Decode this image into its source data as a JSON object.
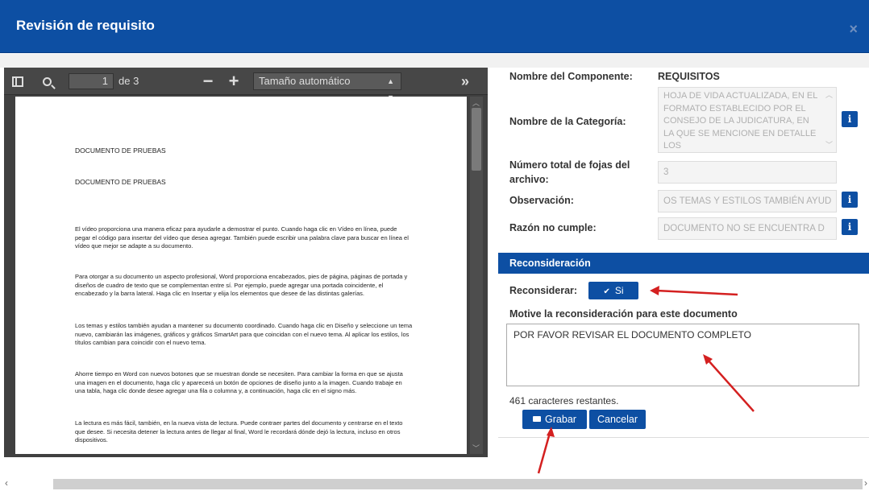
{
  "dialog": {
    "title": "Revisión de requisito",
    "close_glyph": "×"
  },
  "viewer": {
    "page_current": "1",
    "page_of": "de 3",
    "zoom": "Tamaño automático",
    "icons": [
      "sidebar-toggle-icon",
      "search-icon",
      "zoom-out-icon",
      "zoom-in-icon",
      "more-tools-icon"
    ],
    "document": {
      "heading1": "DOCUMENTO DE PRUEBAS",
      "heading2": "DOCUMENTO DE PRUEBAS",
      "paragraphs": [
        "El vídeo proporciona una manera eficaz para ayudarle a demostrar el punto. Cuando haga clic en Vídeo en línea, puede pegar el código para insertar del vídeo que desea agregar. También puede escribir una palabra clave para buscar en línea el vídeo que mejor se adapte a su documento.",
        "Para otorgar a su documento un aspecto profesional, Word proporciona encabezados, pies de página, páginas de portada y diseños de cuadro de texto que se complementan entre sí. Por ejemplo, puede agregar una portada coincidente, el encabezado y la barra lateral. Haga clic en Insertar y elija los elementos que desee de las distintas galerías.",
        "Los temas y estilos también ayudan a mantener su documento coordinado. Cuando haga clic en Diseño y seleccione un tema nuevo, cambiarán las imágenes, gráficos y gráficos SmartArt para que coincidan con el nuevo tema. Al aplicar los estilos, los títulos cambian para coincidir con el nuevo tema.",
        "Ahorre tiempo en Word con nuevos botones que se muestran donde se necesiten. Para cambiar la forma en que se ajusta una imagen en el documento, haga clic y aparecerá un botón de opciones de diseño junto a la imagen. Cuando trabaje en una tabla, haga clic donde desee agregar una fila o columna y, a continuación, haga clic en el signo más.",
        "La lectura es más fácil, también, en la nueva vista de lectura. Puede contraer partes del documento y centrarse en el texto que desee. Si necesita detener la lectura antes de llegar al final, Word le recordará dónde dejó la lectura, incluso en otros dispositivos."
      ]
    }
  },
  "details": {
    "componente_label": "Nombre del Componente:",
    "componente_value": "REQUISITOS",
    "categoria_label": "Nombre de la Categoría:",
    "categoria_value": "HOJA DE VIDA ACTUALIZADA, EN EL FORMATO ESTABLECIDO POR EL CONSEJO DE LA JUDICATURA, EN LA QUE SE MENCIONE EN DETALLE LOS",
    "fojas_label": "Número total de fojas del archivo:",
    "fojas_value": "3",
    "observacion_label": "Observación:",
    "observacion_value": "OS TEMAS Y ESTILOS TAMBIÉN AYUD",
    "razon_label": "Razón no cumple:",
    "razon_value": "DOCUMENTO NO SE ENCUENTRA D",
    "info_glyph": "i"
  },
  "reconsideracion": {
    "header": "Reconsideración",
    "reconsiderar_label": "Reconsiderar:",
    "si_label": "Si",
    "check_glyph": "✔",
    "motivo_label": "Motive la reconsideración para este documento",
    "motivo_value": "POR FAVOR REVISAR EL DOCUMENTO COMPLETO",
    "remaining": "461 caracteres restantes.",
    "grabar_label": "Grabar",
    "cancelar_label": "Cancelar"
  },
  "colors": {
    "brand_blue": "#0d4fa3",
    "annotation_red": "#d42020",
    "viewer_dark": "#474747"
  }
}
